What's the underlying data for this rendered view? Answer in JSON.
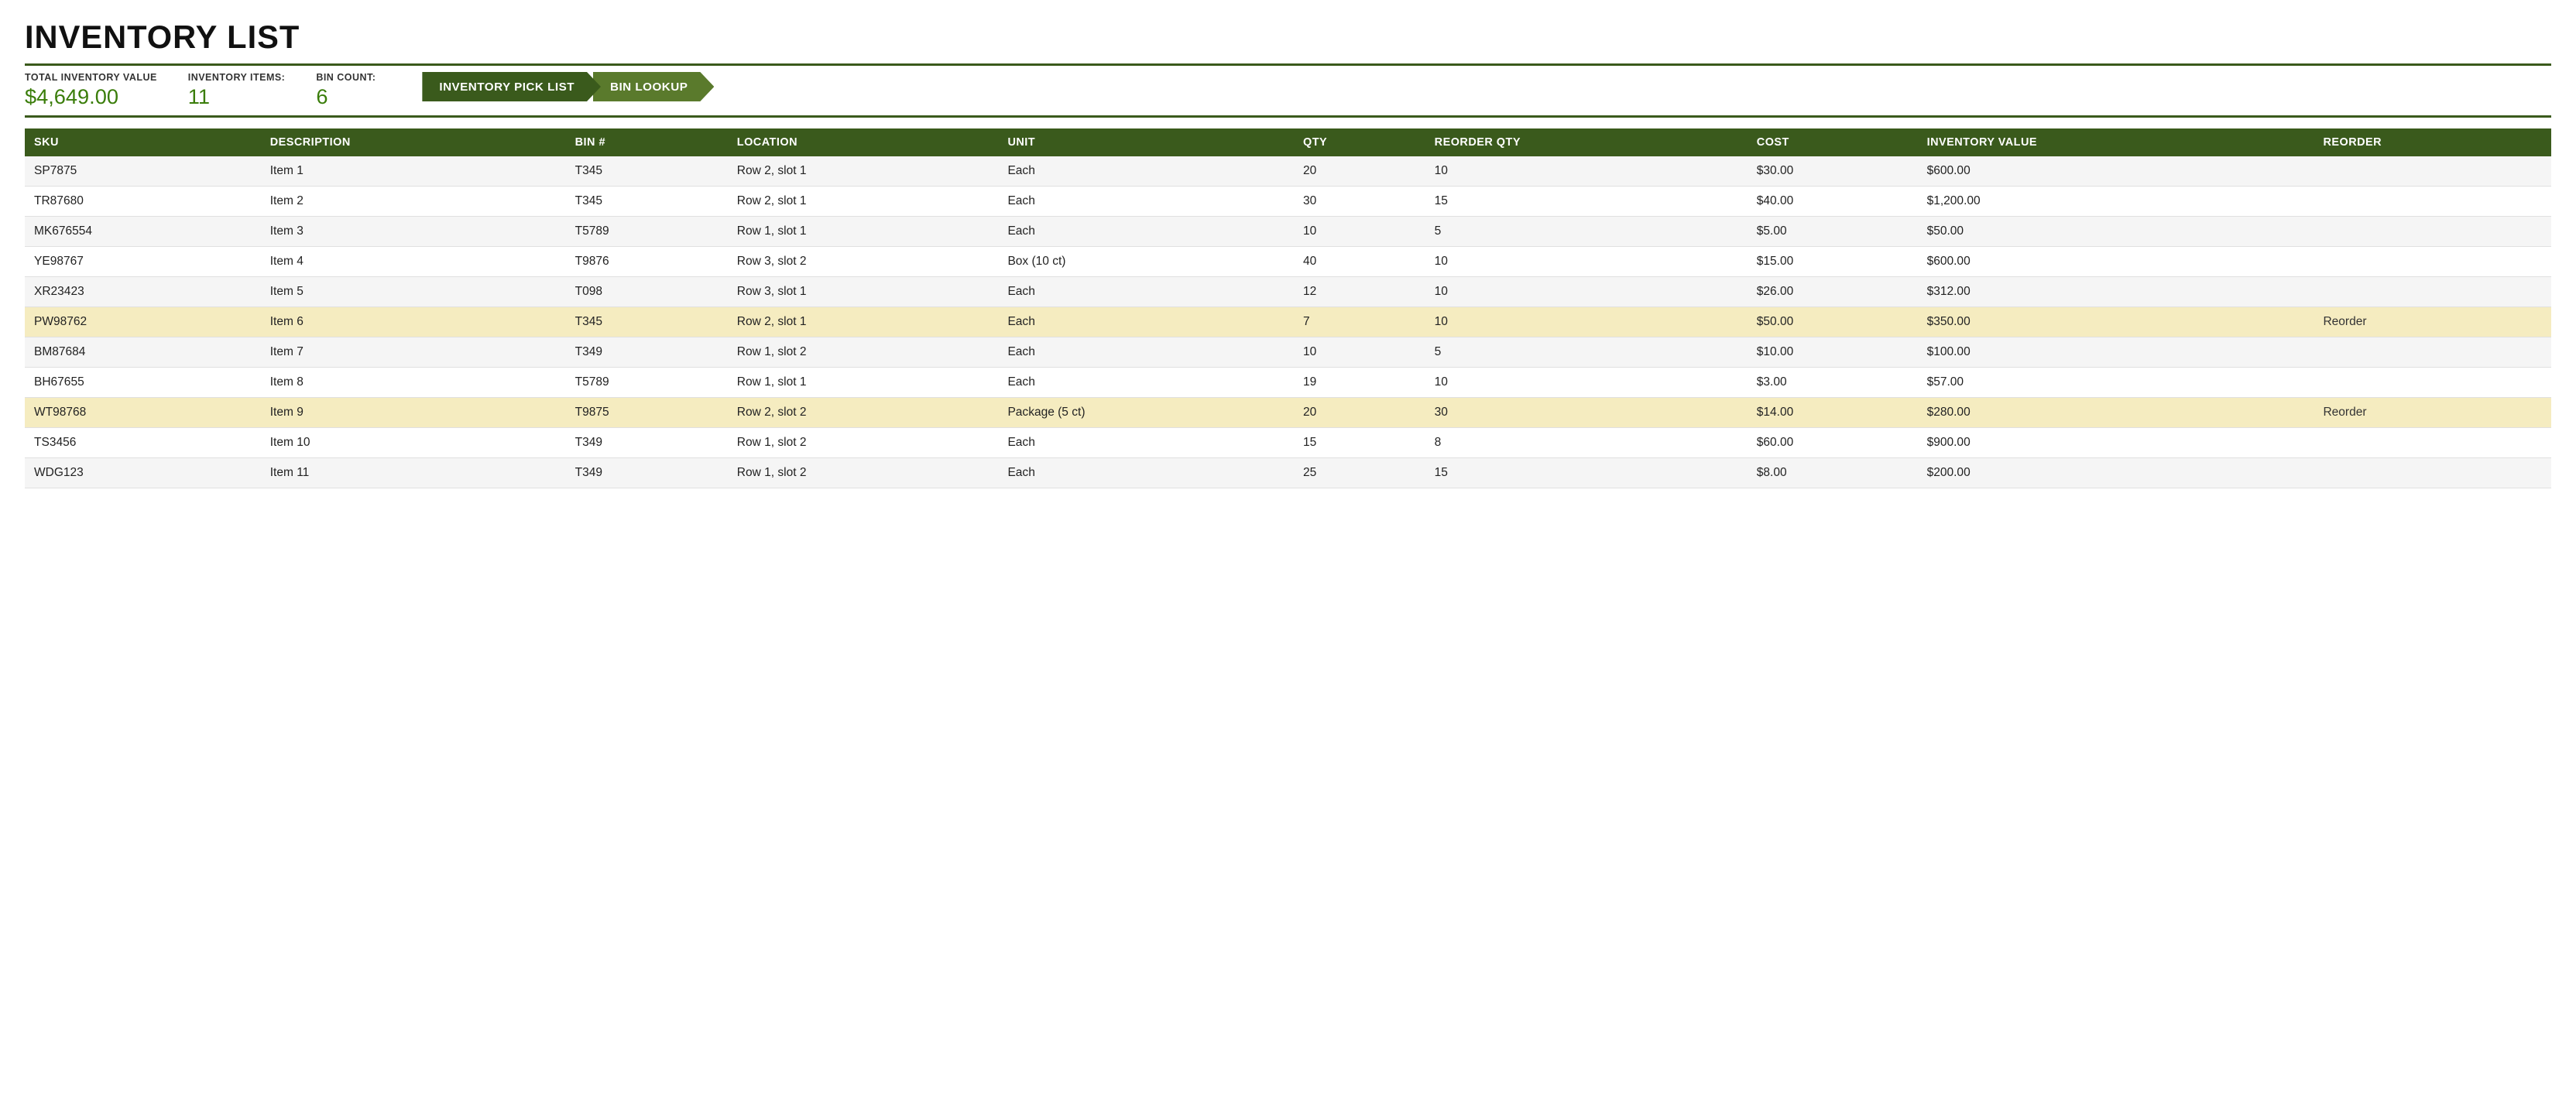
{
  "page": {
    "title": "INVENTORY LIST"
  },
  "stats": {
    "total_inventory_label": "TOTAL INVENTORY VALUE",
    "total_inventory_value": "$4,649.00",
    "inventory_items_label": "INVENTORY ITEMS:",
    "inventory_items_value": "11",
    "bin_count_label": "BIN COUNT:",
    "bin_count_value": "6"
  },
  "nav": {
    "btn1_label": "INVENTORY PICK LIST",
    "btn2_label": "BIN LOOKUP"
  },
  "table": {
    "headers": [
      "SKU",
      "DESCRIPTION",
      "BIN #",
      "LOCATION",
      "UNIT",
      "QTY",
      "REORDER QTY",
      "COST",
      "INVENTORY VALUE",
      "REORDER"
    ],
    "rows": [
      {
        "sku": "SP7875",
        "description": "Item 1",
        "bin": "T345",
        "location": "Row 2, slot 1",
        "unit": "Each",
        "qty": "20",
        "reorder_qty": "10",
        "cost": "$30.00",
        "inv_value": "$600.00",
        "reorder": "",
        "highlight": false
      },
      {
        "sku": "TR87680",
        "description": "Item 2",
        "bin": "T345",
        "location": "Row 2, slot 1",
        "unit": "Each",
        "qty": "30",
        "reorder_qty": "15",
        "cost": "$40.00",
        "inv_value": "$1,200.00",
        "reorder": "",
        "highlight": false
      },
      {
        "sku": "MK676554",
        "description": "Item 3",
        "bin": "T5789",
        "location": "Row 1, slot 1",
        "unit": "Each",
        "qty": "10",
        "reorder_qty": "5",
        "cost": "$5.00",
        "inv_value": "$50.00",
        "reorder": "",
        "highlight": false
      },
      {
        "sku": "YE98767",
        "description": "Item 4",
        "bin": "T9876",
        "location": "Row 3, slot 2",
        "unit": "Box (10 ct)",
        "qty": "40",
        "reorder_qty": "10",
        "cost": "$15.00",
        "inv_value": "$600.00",
        "reorder": "",
        "highlight": false
      },
      {
        "sku": "XR23423",
        "description": "Item 5",
        "bin": "T098",
        "location": "Row 3, slot 1",
        "unit": "Each",
        "qty": "12",
        "reorder_qty": "10",
        "cost": "$26.00",
        "inv_value": "$312.00",
        "reorder": "",
        "highlight": false
      },
      {
        "sku": "PW98762",
        "description": "Item 6",
        "bin": "T345",
        "location": "Row 2, slot 1",
        "unit": "Each",
        "qty": "7",
        "reorder_qty": "10",
        "cost": "$50.00",
        "inv_value": "$350.00",
        "reorder": "Reorder",
        "highlight": true
      },
      {
        "sku": "BM87684",
        "description": "Item 7",
        "bin": "T349",
        "location": "Row 1, slot 2",
        "unit": "Each",
        "qty": "10",
        "reorder_qty": "5",
        "cost": "$10.00",
        "inv_value": "$100.00",
        "reorder": "",
        "highlight": false
      },
      {
        "sku": "BH67655",
        "description": "Item 8",
        "bin": "T5789",
        "location": "Row 1, slot 1",
        "unit": "Each",
        "qty": "19",
        "reorder_qty": "10",
        "cost": "$3.00",
        "inv_value": "$57.00",
        "reorder": "",
        "highlight": false
      },
      {
        "sku": "WT98768",
        "description": "Item 9",
        "bin": "T9875",
        "location": "Row 2, slot 2",
        "unit": "Package (5 ct)",
        "qty": "20",
        "reorder_qty": "30",
        "cost": "$14.00",
        "inv_value": "$280.00",
        "reorder": "Reorder",
        "highlight": true
      },
      {
        "sku": "TS3456",
        "description": "Item 10",
        "bin": "T349",
        "location": "Row 1, slot 2",
        "unit": "Each",
        "qty": "15",
        "reorder_qty": "8",
        "cost": "$60.00",
        "inv_value": "$900.00",
        "reorder": "",
        "highlight": false
      },
      {
        "sku": "WDG123",
        "description": "Item 11",
        "bin": "T349",
        "location": "Row 1, slot 2",
        "unit": "Each",
        "qty": "25",
        "reorder_qty": "15",
        "cost": "$8.00",
        "inv_value": "$200.00",
        "reorder": "",
        "highlight": false
      }
    ]
  }
}
